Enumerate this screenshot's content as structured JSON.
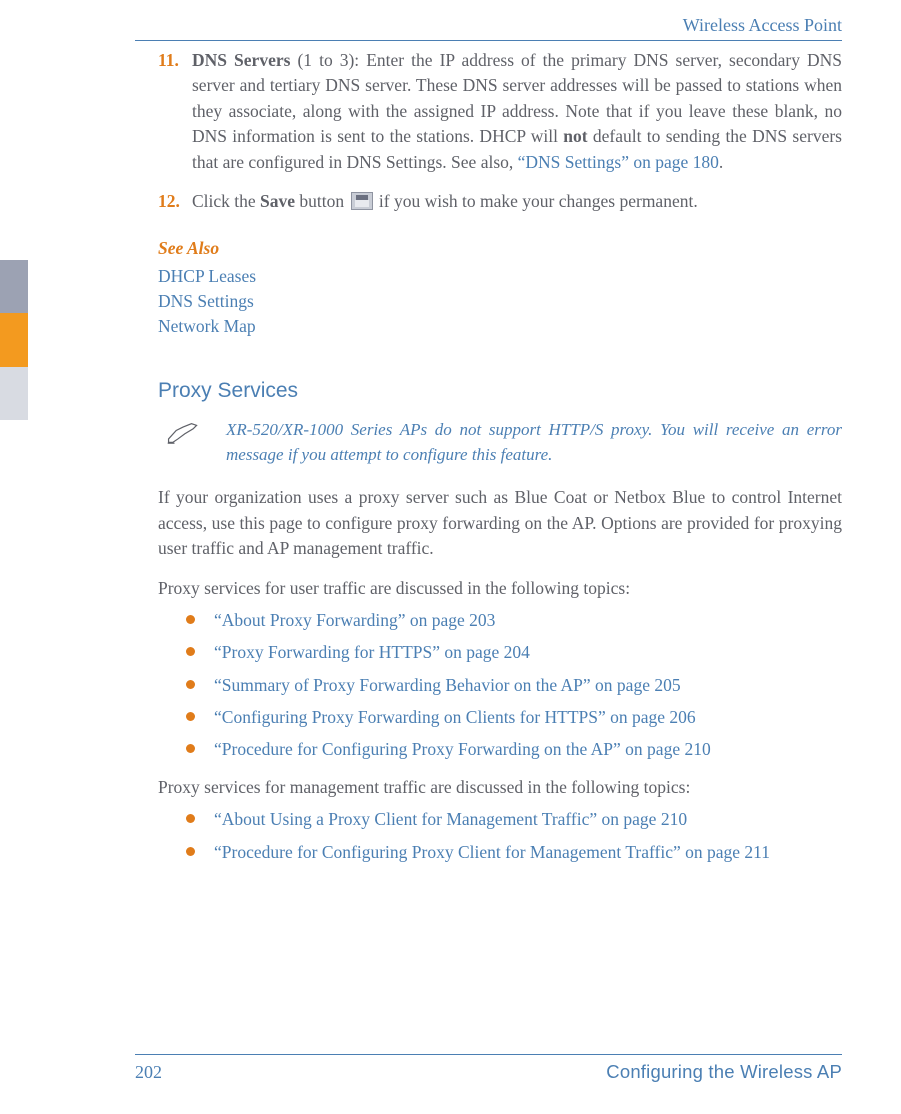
{
  "header": {
    "title": "Wireless Access Point"
  },
  "footer": {
    "page": "202",
    "chapter": "Configuring the Wireless AP"
  },
  "steps": {
    "s11": {
      "num": "11.",
      "title": "DNS Servers",
      "range": " (1 to 3): ",
      "body_a": "Enter the IP address of the primary DNS server, secondary DNS server and tertiary DNS server. These DNS server addresses will be passed to stations when they associate, along with the assigned IP address. Note that if you leave these blank, no DNS information is sent to the stations. DHCP will ",
      "not": "not",
      "body_b": " default to sending the DNS servers that are configured in DNS Settings. See also, ",
      "link": "“DNS Settings” on page 180",
      "tail": "."
    },
    "s12": {
      "num": "12.",
      "pre": "Click the ",
      "save": "Save",
      "mid": " button ",
      "post": " if you wish to make your changes permanent."
    }
  },
  "see_also": {
    "heading": "See Also",
    "items": [
      "DHCP Leases",
      "DNS Settings",
      "Network Map"
    ]
  },
  "section": {
    "heading": "Proxy Services"
  },
  "note": {
    "text": "XR-520/XR-1000 Series APs do not support HTTP/S proxy. You will receive an error message if you attempt to configure this feature."
  },
  "para1": "If your organization uses a proxy server such as Blue Coat or Netbox Blue to control Internet access, use this page to configure proxy forwarding on the AP. Options are provided for proxying user traffic and AP management traffic.",
  "para2": "Proxy services for user traffic are discussed in the following topics:",
  "list_user": [
    "“About Proxy Forwarding” on page 203",
    "“Proxy Forwarding for HTTPS” on page 204",
    "“Summary of Proxy Forwarding Behavior on the AP” on page 205",
    "“Configuring Proxy Forwarding on Clients for HTTPS” on page 206",
    "“Procedure for Configuring Proxy Forwarding on the AP” on page 210"
  ],
  "para3": "Proxy services for management traffic are discussed in the following topics:",
  "list_mgmt": [
    "“About Using a Proxy Client for Management Traffic” on page 210",
    "“Procedure for Configuring Proxy Client for Management Traffic” on page 211"
  ]
}
